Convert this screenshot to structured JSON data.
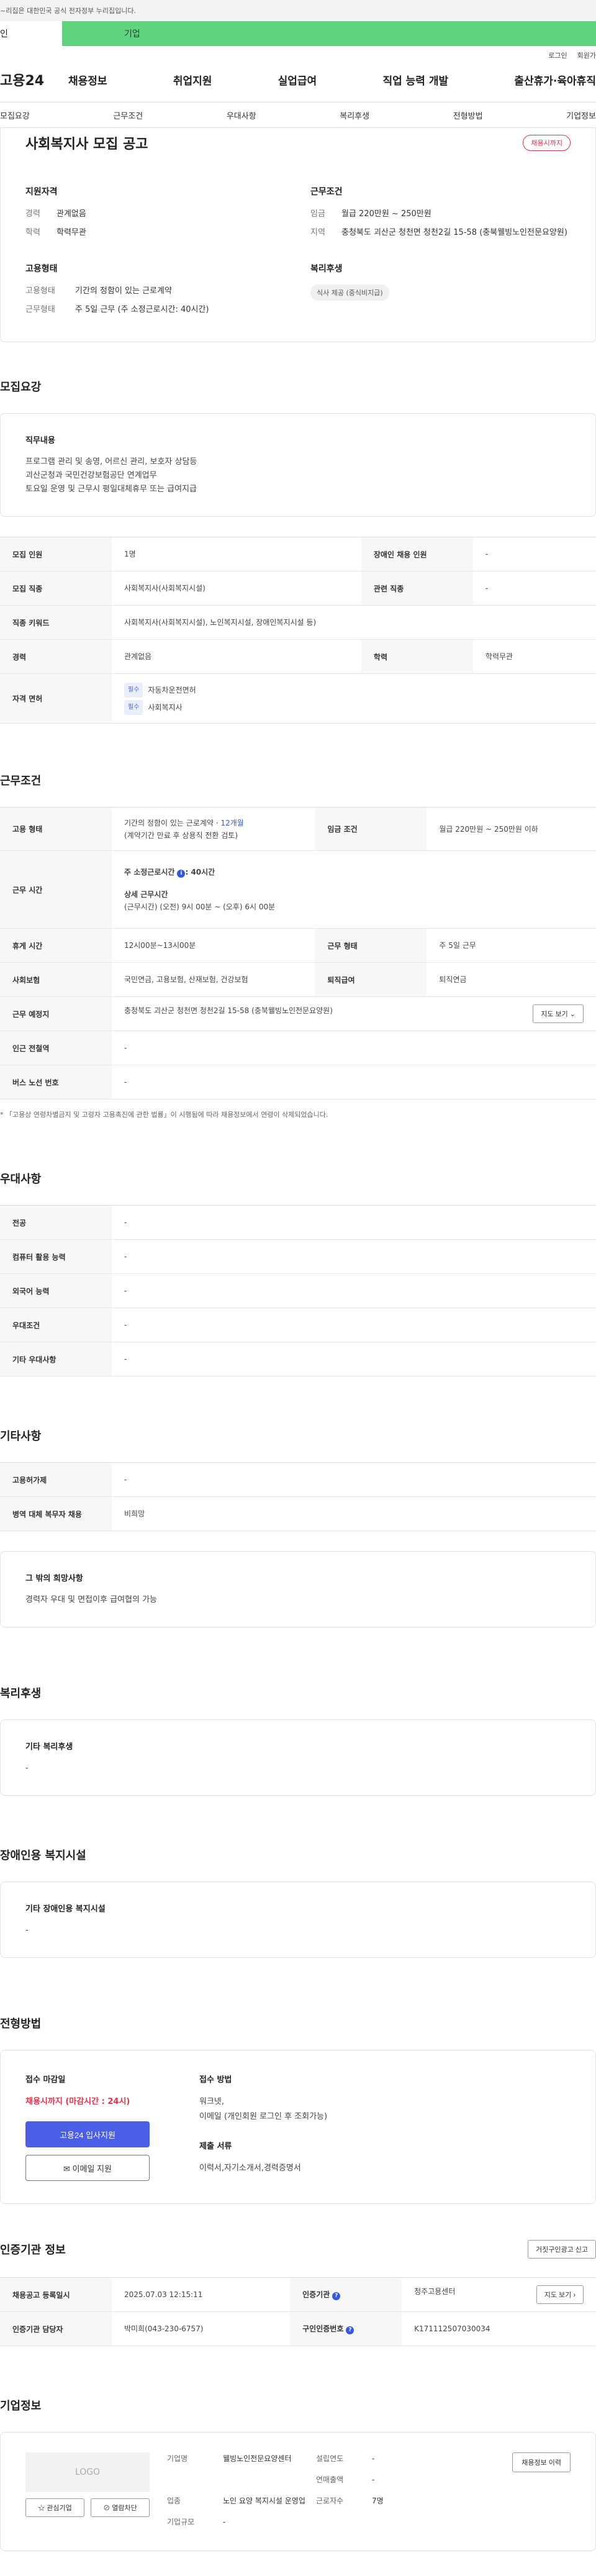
{
  "gov_notice": "~리집은 대한민국 공식 전자정부 누리집입니다.",
  "user_tabs": {
    "person": "인",
    "company": "기업"
  },
  "util_links": [
    "로그인",
    "회원가"
  ],
  "gnb": {
    "logo": "고용24",
    "menu": [
      "채용정보",
      "취업지원",
      "실업급여",
      "직업 능력 개발",
      "출산휴가·육아휴직"
    ]
  },
  "subnav": [
    "모집요강",
    "근무조건",
    "우대사항",
    "복리후생",
    "전형방법",
    "기업정보"
  ],
  "job": {
    "title": "사회복지사 모집 공고",
    "badge": "채용시까지",
    "qual": {
      "heading": "지원자격",
      "items": [
        {
          "k": "경력",
          "v": "관계없음"
        },
        {
          "k": "학력",
          "v": "학력무관"
        }
      ]
    },
    "cond": {
      "heading": "근무조건",
      "items": [
        {
          "k": "임금",
          "v": "월급 220만원 ~ 250만원"
        },
        {
          "k": "지역",
          "v": "충청북도 괴산군 청천면 청천2길 15-58 (충북웰빙노인전문요양원)"
        }
      ]
    },
    "emp": {
      "heading": "고용형태",
      "items": [
        {
          "k": "고용형태",
          "v": "기간의 정함이 있는 근로계약"
        },
        {
          "k": "근무형태",
          "v": "주 5일 근무 (주 소정근로시간: 40시간)"
        }
      ]
    },
    "welfare": {
      "heading": "복리후생",
      "tag": "식사 제공 (중식비지급)"
    }
  },
  "recruit": {
    "title": "모집요강",
    "duty_heading": "직무내용",
    "duty_lines": [
      "프로그램 관리 및 송영, 어르신 관리, 보호자 상담등",
      "괴산군청과 국민건강보험공단 연계업무",
      "토요일 운영 및 근무시 평일대체휴무 또는 급여지급"
    ],
    "rows": {
      "count_k": "모집 인원",
      "count_v": "1명",
      "disabled_k": "장애인 채용 인원",
      "disabled_v": "-",
      "occ_k": "모집 직종",
      "occ_v": "사회복지사(사회복지시설)",
      "related_k": "관련 직종",
      "related_v": "-",
      "keyword_k": "직종 키워드",
      "keyword_v": "사회복지사(사회복지시설), 노인복지시설, 장애인복지시설 등)",
      "career_k": "경력",
      "career_v": "관계없음",
      "edu_k": "학력",
      "edu_v": "학력무관",
      "license_k": "자격 면허",
      "license_tag": "필수",
      "licenses": [
        "자동차운전면허",
        "사회복지사"
      ]
    }
  },
  "work": {
    "title": "근무조건",
    "emp_k": "고용 형태",
    "emp_v1": "기간의 정함이 있는 근로계약 · ",
    "emp_v1_blue": "12개월",
    "emp_v2": "(계약기간 만료 후 상용직 전환 검토)",
    "wage_k": "임금 조건",
    "wage_v": "월급 220만원 ~ 250만원 이하",
    "time_k": "근무 시간",
    "time_std": "주 소정근로시간",
    "time_std_v": ": 40시간",
    "time_detail_h": "상세 근무시간",
    "time_detail_v": "(근무시간) (오전) 9시 00분 ~ (오후) 6시 00분",
    "break_k": "휴게 시간",
    "break_v": "12시00분~13시00분",
    "type_k": "근무 형태",
    "type_v": "주 5일 근무",
    "ins_k": "사회보험",
    "ins_v": "국민연금, 고용보험, 산재보험, 건강보험",
    "retire_k": "퇴직급여",
    "retire_v": "퇴직연금",
    "place_k": "근무 예정지",
    "place_v": "충청북도 괴산군 청천면 청천2길 15-58 (충북웰빙노인전문요양원)",
    "map_btn": "지도 보기 ⌄",
    "station_k": "인근 전철역",
    "station_v": "-",
    "bus_k": "버스 노선 번호",
    "bus_v": "-",
    "footnote": "* 「고용상 연령차별금지 및 고령자 고용촉진에 관한 법률」이 시행됨에 따라 채용정보에서 연령이 삭제되었습니다."
  },
  "pref": {
    "title": "우대사항",
    "rows": [
      {
        "k": "전공",
        "v": "-"
      },
      {
        "k": "컴퓨터 활용 능력",
        "v": "-"
      },
      {
        "k": "외국어 능력",
        "v": "-"
      },
      {
        "k": "우대조건",
        "v": "-"
      },
      {
        "k": "기타 우대사항",
        "v": "-"
      }
    ]
  },
  "etc": {
    "title": "기타사항",
    "rows": [
      {
        "k": "고용허가제",
        "v": "-"
      },
      {
        "k": "병역 대체 복무자 채용",
        "v": "비희망"
      }
    ],
    "box_heading": "그 밖의 희망사항",
    "box_text": "경력자 우대 및 면접이후 급여협의 가능"
  },
  "benefit": {
    "title": "복리후생",
    "box_heading": "기타 복리후생",
    "box_text": "-"
  },
  "disability": {
    "title": "장애인용 복지시설",
    "box_heading": "기타 장애인용 복지시설",
    "box_text": "-"
  },
  "apply": {
    "title": "전형방법",
    "deadline_h": "접수 마감일",
    "deadline_v": "채용시까지 (마감시간 : 24시)",
    "btn_primary": "고용24 입사지원",
    "btn_email": "✉ 이메일 지원",
    "method_h": "접수 방법",
    "method_lines": [
      "워크넷,",
      "이메일 (개인회원 로그인 후 조회가능)"
    ],
    "docs_h": "제출 서류",
    "docs_v": "이력서,자기소개서,경력증명서"
  },
  "cert": {
    "title": "인증기관 정보",
    "report_btn": "거짓구인광고 신고",
    "reg_k": "채용공고 등록일시",
    "reg_v": "2025.07.03 12:15:11",
    "org_k": "인증기관",
    "org_v": "청주고용센터",
    "map_btn": "지도 보기 ›",
    "mgr_k": "인증기관 담당자",
    "mgr_v": "박미희(043-230-6757)",
    "no_k": "구인인증번호",
    "no_v": "K171112507030034"
  },
  "company": {
    "title": "기업정보",
    "logo": "LOGO",
    "btn_interest": "☆ 관심기업",
    "btn_block": "⊘ 열람차단",
    "name_k": "기업명",
    "name_v": "웰빙노인전문요양센터",
    "est_k": "설립연도",
    "est_v": "-",
    "sales_k": "연매출액",
    "sales_v": "-",
    "ind_k": "업종",
    "ind_v": "노인 요양 복지시설 운영업",
    "emp_k": "근로자수",
    "emp_v": "7명",
    "size_k": "기업규모",
    "size_v": "-",
    "history_btn": "채용정보 이력"
  }
}
